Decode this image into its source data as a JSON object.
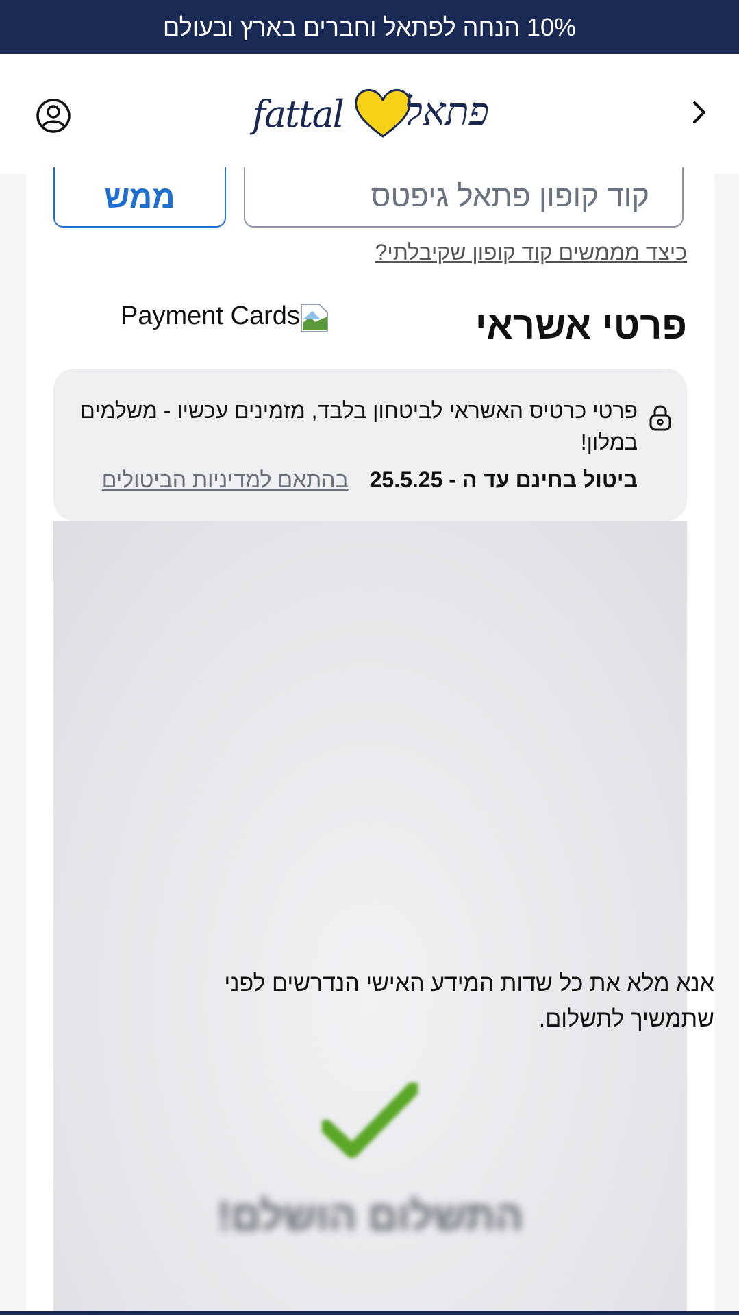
{
  "promo": {
    "text": "10% הנחה לפתאל וחברים בארץ ובעולם"
  },
  "header": {
    "logo_latin": "fattal",
    "logo_hebrew": "פתאל",
    "back_icon": "chevron-right-icon",
    "account_icon": "user-circle-icon"
  },
  "coupon": {
    "placeholder": "קוד קופון פתאל גיפטס",
    "redeem_label": "ממש",
    "help_link": "כיצד מממשים קוד קופון שקיבלתי?"
  },
  "payment": {
    "title": "פרטי אשראי",
    "cards_alt": "Payment Cards",
    "notice_text": "פרטי כרטיס האשראי לביטחון בלבד, מזמינים עכשיו - משלמים במלון!",
    "cancel_bold": "ביטול בחינם עד ה - 25.5.25",
    "cancel_link": "בהתאם למדיניות הביטולים",
    "frame_success_text": "התשלום הושלם!",
    "fill_warning": "אנא מלא את כל שדות המידע האישי הנדרשים לפני שתמשיך לתשלום."
  },
  "colors": {
    "brand_navy": "#1b2a55",
    "brand_yellow": "#f7d117",
    "link_blue": "#1f6fd1",
    "check_green": "#5aa626"
  }
}
